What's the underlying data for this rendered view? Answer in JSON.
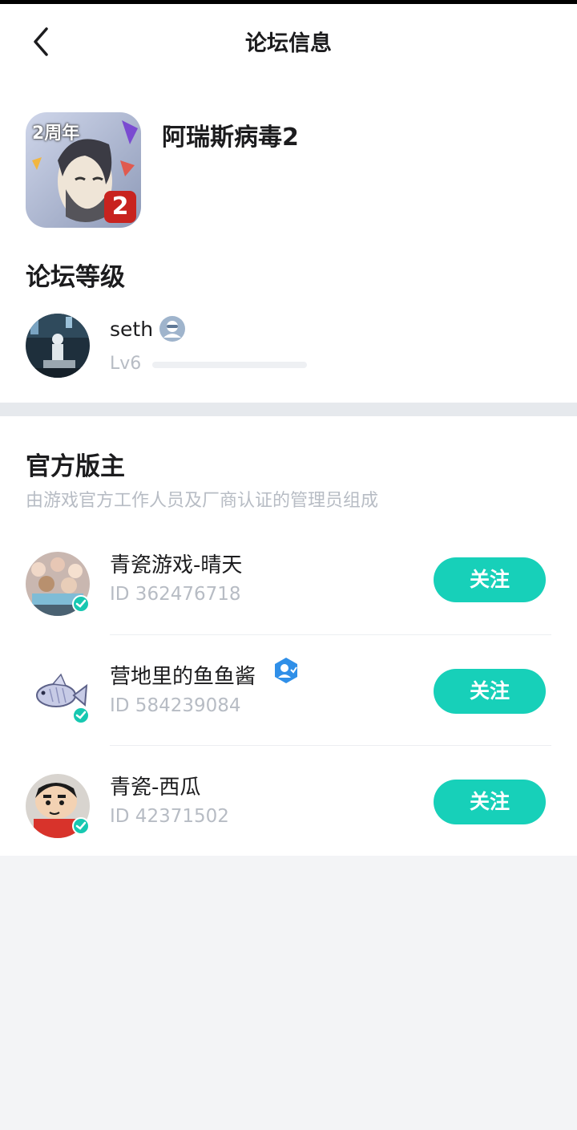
{
  "header": {
    "title": "论坛信息",
    "back_icon": "back-chevron-icon"
  },
  "game": {
    "name": "阿瑞斯病毒2",
    "icon": "game-cover-icon",
    "icon_badge_text": "2周年",
    "icon_corner_text": "2"
  },
  "forum_level": {
    "title": "论坛等级",
    "user": {
      "name": "seth",
      "badge_icon": "user-badge-icon",
      "level": "Lv6",
      "progress": 0.0
    }
  },
  "moderators": {
    "title": "官方版主",
    "subtitle": "由游戏官方工作人员及厂商认证的管理员组成",
    "follow_label": "关注",
    "items": [
      {
        "name": "青瓷游戏-晴天",
        "id": "ID 362476718",
        "verified": true
      },
      {
        "name": "营地里的鱼鱼酱",
        "id": "ID 584239084",
        "verified": true,
        "badge_icon": "hexagon-user-badge-icon"
      },
      {
        "name": "青瓷-西瓜",
        "id": "ID 42371502",
        "verified": true
      }
    ]
  },
  "colors": {
    "accent": "#17d0b9",
    "verify": "#17c8b1",
    "muted": "#b7bcc4",
    "divider": "#e6e9ed"
  }
}
